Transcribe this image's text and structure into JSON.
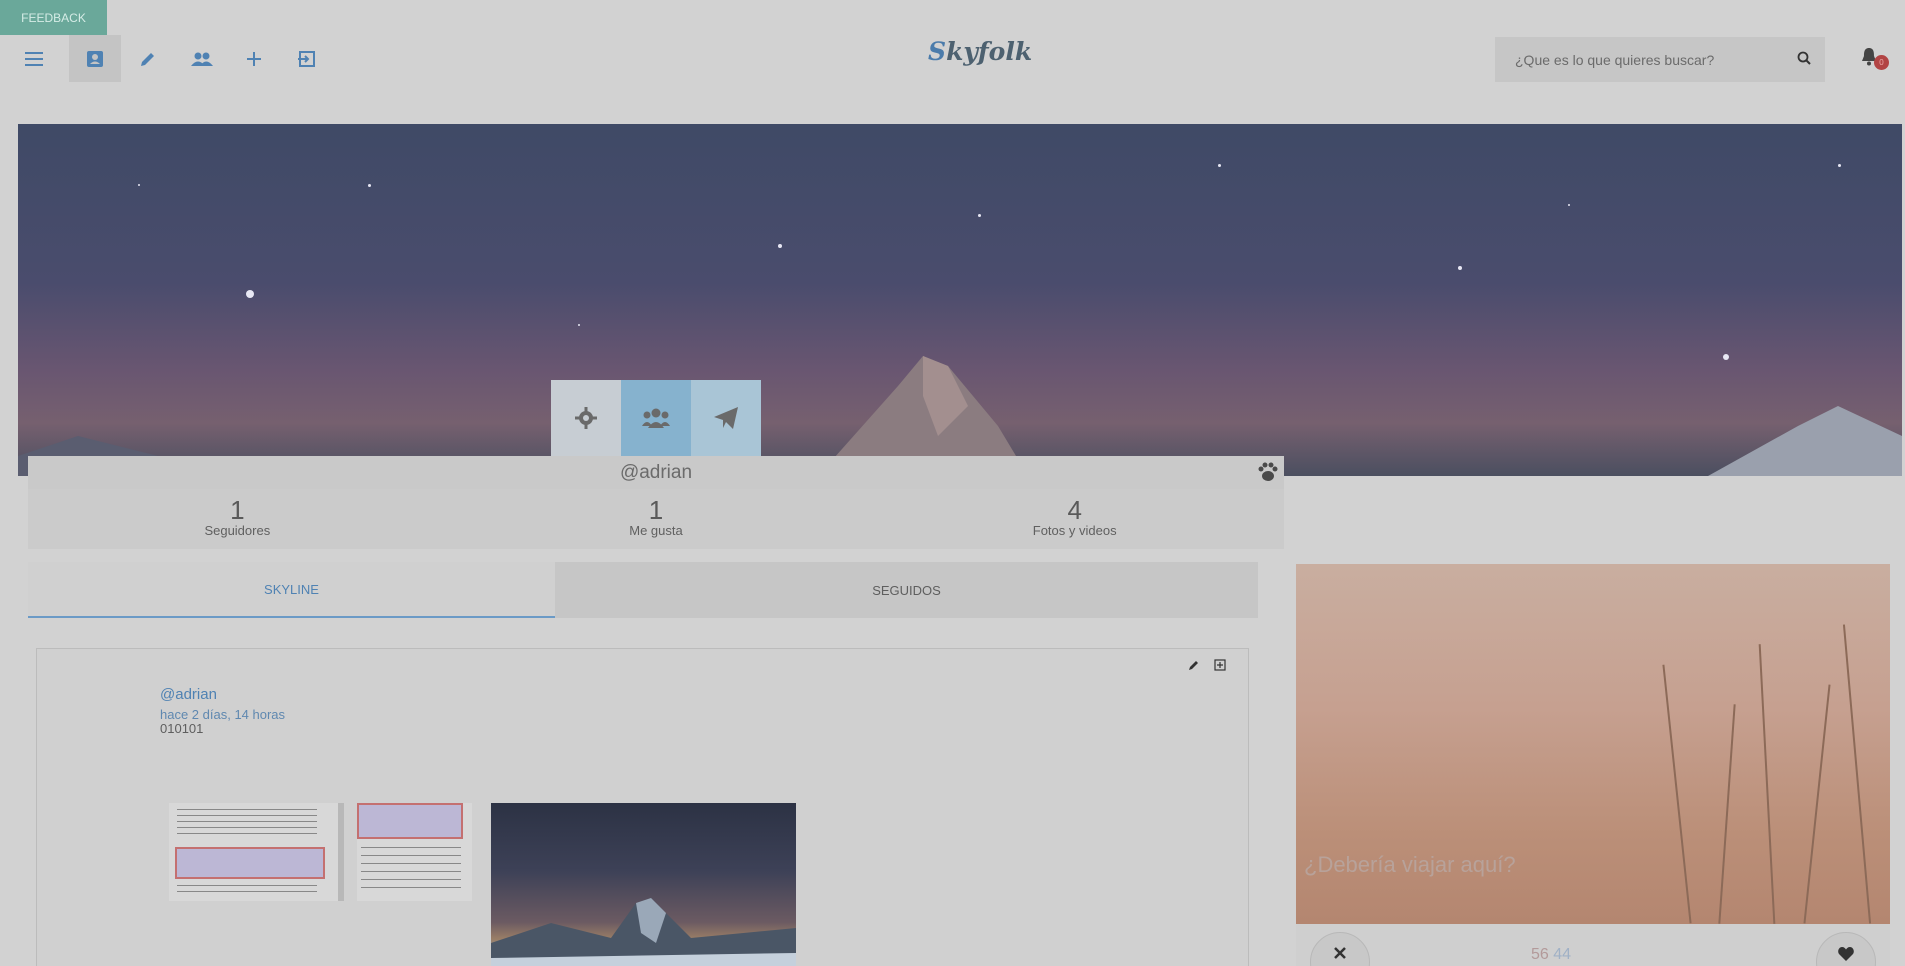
{
  "feedback_label": "FEEDBACK",
  "nav": {
    "items": [
      {
        "name": "menu-icon"
      },
      {
        "name": "profile-icon"
      },
      {
        "name": "edit-icon"
      },
      {
        "name": "people-icon"
      },
      {
        "name": "add-icon"
      },
      {
        "name": "logout-icon"
      }
    ],
    "active_index": 1
  },
  "brand": {
    "first_letter": "S",
    "rest": "kyfolk"
  },
  "search": {
    "placeholder": "¿Que es lo que quieres buscar?"
  },
  "notifications": {
    "count": "0"
  },
  "profile": {
    "username": "@adrian",
    "stats": [
      {
        "value": "1",
        "label": "Seguidores"
      },
      {
        "value": "1",
        "label": "Me gusta"
      },
      {
        "value": "4",
        "label": "Fotos y videos"
      }
    ]
  },
  "tabs": [
    {
      "label": "SKYLINE",
      "active": true
    },
    {
      "label": "SEGUIDOS",
      "active": false
    }
  ],
  "post": {
    "author": "@adrian",
    "time": "hace 2 días, 14 horas",
    "text": "010101"
  },
  "suggestion": {
    "question": "¿Debería viajar aquí?",
    "likes": "56",
    "dislikes": "44"
  },
  "colors": {
    "accent": "#4f82b3",
    "feedback": "#6aa89a",
    "badge": "#b24444"
  }
}
